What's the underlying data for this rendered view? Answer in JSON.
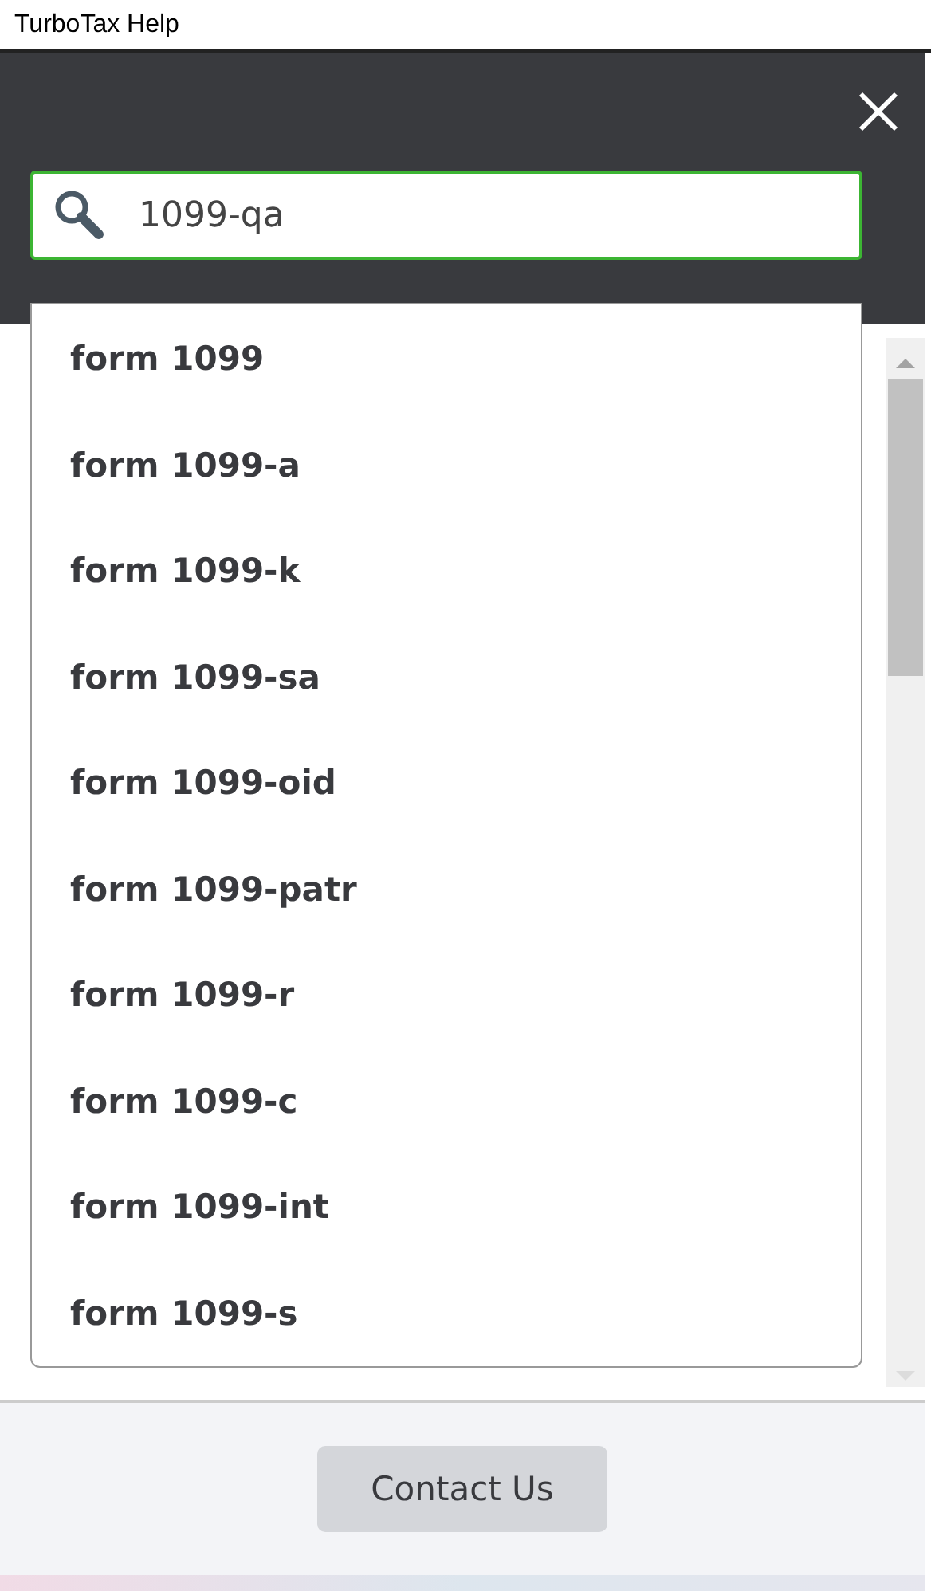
{
  "window": {
    "title": "TurboTax Help"
  },
  "search": {
    "value": "1099-qa"
  },
  "suggestions": [
    {
      "label": "form 1099"
    },
    {
      "label": "form 1099-a"
    },
    {
      "label": "form 1099-k"
    },
    {
      "label": "form 1099-sa"
    },
    {
      "label": "form 1099-oid"
    },
    {
      "label": "form 1099-patr"
    },
    {
      "label": "form 1099-r"
    },
    {
      "label": "form 1099-c"
    },
    {
      "label": "form 1099-int"
    },
    {
      "label": "form 1099-s"
    }
  ],
  "footer": {
    "button": "Contact Us"
  }
}
